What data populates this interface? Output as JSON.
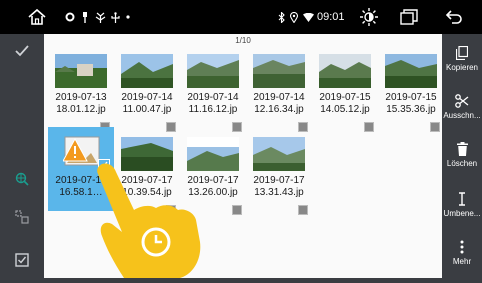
{
  "status_bar": {
    "home_icon": "home-icon",
    "notification_icons": [
      "settings-icon",
      "usb-icon",
      "antenna-icon",
      "usb-trident-icon",
      "dot-icon"
    ],
    "bluetooth_icon": "bluetooth-icon",
    "location_icon": "location-icon",
    "wifi_icon": "wifi-icon",
    "time": "09:01",
    "brightness_icon": "brightness-icon",
    "recents_icon": "recents-icon",
    "back_icon": "back-icon"
  },
  "left_rail": [
    "check-icon",
    "globe-search-icon",
    "crop-select-icon",
    "checkbox-icon"
  ],
  "right_rail": [
    {
      "icon": "copy-icon",
      "label": "Kopieren"
    },
    {
      "icon": "scissors-icon",
      "label": "Ausschn..."
    },
    {
      "icon": "trash-icon",
      "label": "Löschen"
    },
    {
      "icon": "text-cursor-icon",
      "label": "Umbene..."
    },
    {
      "icon": "more-icon",
      "label": "Mehr"
    }
  ],
  "page_indicator": "1/10",
  "files": [
    {
      "name": "2019-07-13\n18.01.12.jp",
      "selected": false,
      "thumb": "photo"
    },
    {
      "name": "2019-07-14\n11.00.47.jp",
      "selected": false,
      "thumb": "photo"
    },
    {
      "name": "2019-07-14\n11.16.12.jp",
      "selected": false,
      "thumb": "photo"
    },
    {
      "name": "2019-07-14\n12.16.34.jp",
      "selected": false,
      "thumb": "photo"
    },
    {
      "name": "2019-07-15\n14.05.12.jp",
      "selected": false,
      "thumb": "photo"
    },
    {
      "name": "2019-07-15\n15.35.36.jp",
      "selected": false,
      "thumb": "photo"
    },
    {
      "name": "2019-07-15\n16.58.1…",
      "selected": true,
      "thumb": "broken-image-warning-icon"
    },
    {
      "name": "2019-07-17\n10.39.54.jp",
      "selected": false,
      "thumb": "photo"
    },
    {
      "name": "2019-07-17\n13.26.00.jp",
      "selected": false,
      "thumb": "photo"
    },
    {
      "name": "2019-07-17\n13.31.43.jp",
      "selected": false,
      "thumb": "photo"
    }
  ],
  "colors": {
    "selection": "#5ab6ea",
    "accent": "#1a9e8f",
    "hand": "#f6c21b"
  }
}
